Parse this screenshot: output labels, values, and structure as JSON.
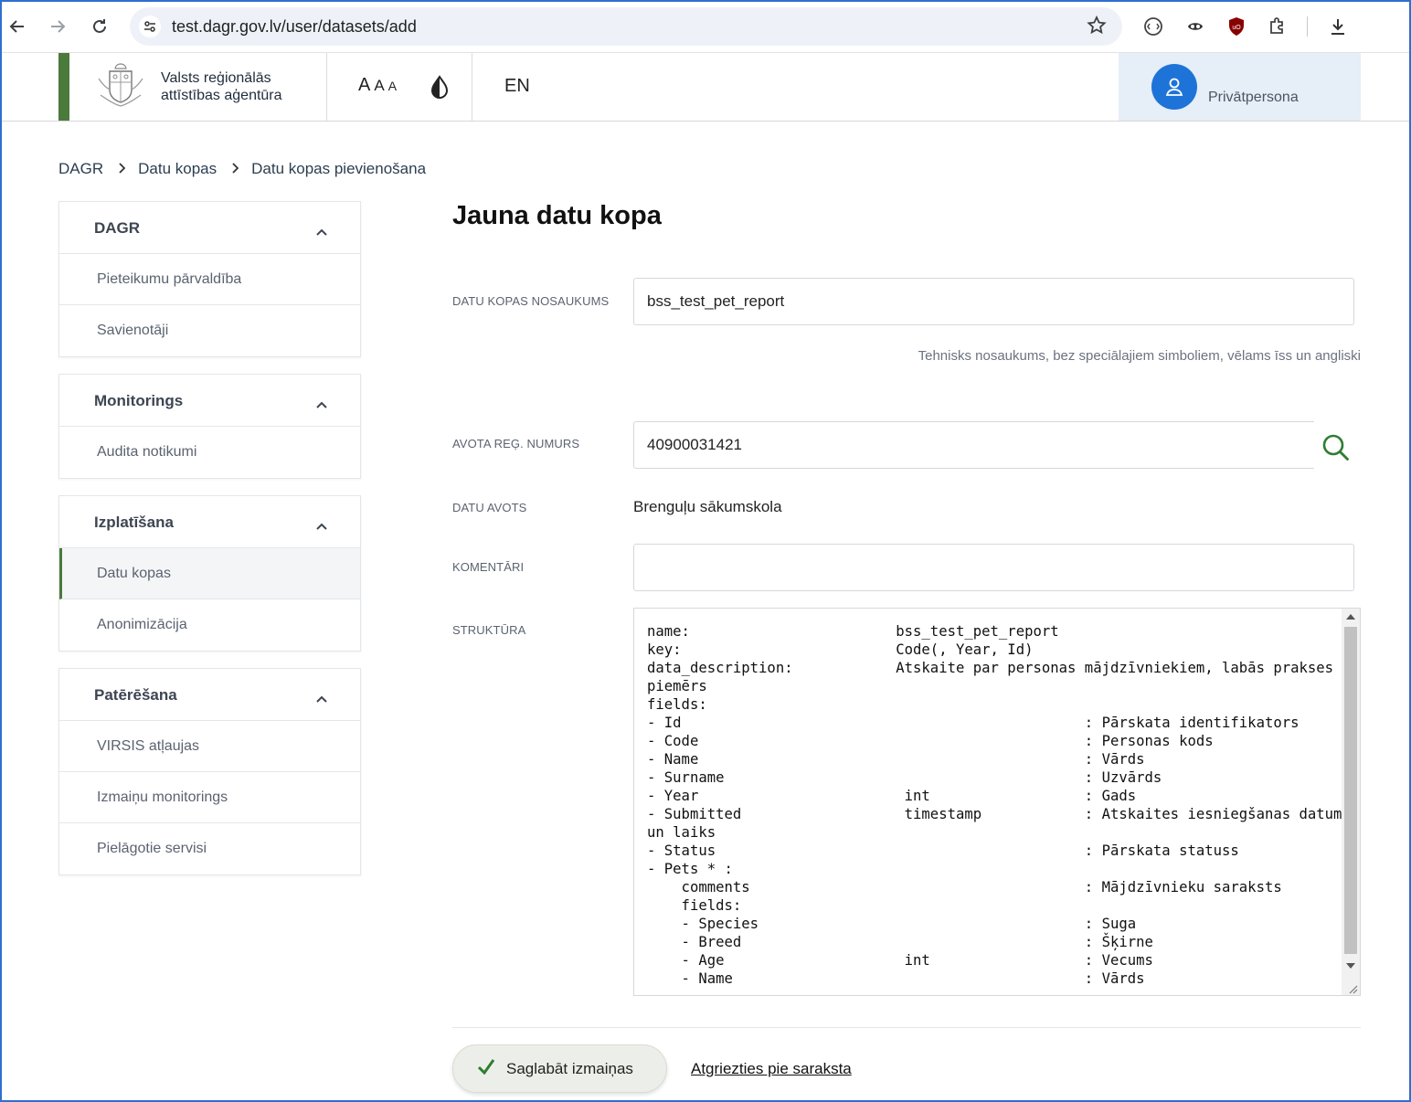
{
  "browser": {
    "url": "test.dagr.gov.lv/user/datasets/add"
  },
  "header": {
    "org_name_line1": "Valsts reģionālās",
    "org_name_line2": "attīstības aģentūra",
    "font_sizes": [
      "A",
      "A",
      "A"
    ],
    "language": "EN",
    "user_name": "Privātpersona"
  },
  "breadcrumb": {
    "items": [
      "DAGR",
      "Datu kopas",
      "Datu kopas pievienošana"
    ]
  },
  "sidebar": {
    "groups": [
      {
        "title": "DAGR",
        "items": [
          "Pieteikumu pārvaldība",
          "Savienotāji"
        ]
      },
      {
        "title": "Monitorings",
        "items": [
          "Audita notikumi"
        ]
      },
      {
        "title": "Izplatīšana",
        "items": [
          "Datu kopas",
          "Anonimizācija"
        ],
        "active": "Datu kopas"
      },
      {
        "title": "Patērēšana",
        "items": [
          "VIRSIS atļaujas",
          "Izmaiņu monitorings",
          "Pielāgotie servisi"
        ]
      }
    ]
  },
  "form": {
    "title": "Jauna datu kopa",
    "name_label": "DATU KOPAS NOSAUKUMS",
    "name_value": "bss_test_pet_report",
    "name_hint": "Tehnisks nosaukums, bez speciālajiem simboliem, vēlams īss un angliski",
    "reg_label": "AVOTA REĢ. NUMURS",
    "reg_value": "40900031421",
    "source_label": "DATU AVOTS",
    "source_value": "Brenguļu sākumskola",
    "comments_label": "KOMENTĀRI",
    "comments_value": "",
    "structure_label": "STRUKTŪRA",
    "structure_value": "name:                        bss_test_pet_report\nkey:                         Code(, Year, Id)\ndata_description:            Atskaite par personas mājdzīvniekiem, labās prakses\npiemērs\nfields:\n- Id                                               : Pārskata identifikators\n- Code                                             : Personas kods\n- Name                                             : Vārds\n- Surname                                          : Uzvārds\n- Year                        int                  : Gads\n- Submitted                   timestamp            : Atskaites iesniegšanas datums\nun laiks\n- Status                                           : Pārskata statuss\n- Pets * :\n    comments                                       : Mājdzīvnieku saraksts\n    fields:\n    - Species                                      : Suga\n    - Breed                                        : Šķirne\n    - Age                     int                  : Vecums\n    - Name                                         : Vārds",
    "save_label": "Saglabāt izmaiņas",
    "back_label": "Atgriezties pie saraksta"
  },
  "colors": {
    "brand_green": "#4a7a3c",
    "user_blue": "#1e73d8",
    "user_box_bg": "#e6eef8",
    "search_icon": "#2e7d32"
  }
}
